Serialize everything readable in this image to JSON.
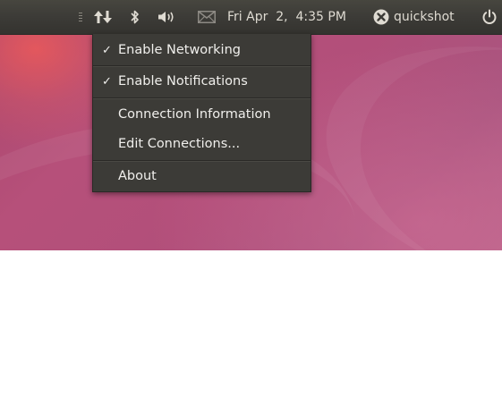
{
  "panel": {
    "clock": "Fri Apr  2,  4:35 PM",
    "user": "quickshot",
    "icons": [
      "network-updown-icon",
      "bluetooth-icon",
      "volume-icon",
      "mail-icon",
      "user-status-icon",
      "power-icon"
    ]
  },
  "network_menu": {
    "items": [
      {
        "label": "Enable Networking",
        "checked": true
      },
      {
        "label": "Enable Notifications",
        "checked": true
      },
      {
        "label": "Connection Information",
        "checked": false
      },
      {
        "label": "Edit Connections...",
        "checked": false
      },
      {
        "label": "About",
        "checked": false
      }
    ],
    "check_glyph": "✓"
  },
  "colors": {
    "panel": "#3c3b37",
    "menu": "#3c3b37",
    "text": "#dfdbd2",
    "desktop": "#b24f7a"
  }
}
